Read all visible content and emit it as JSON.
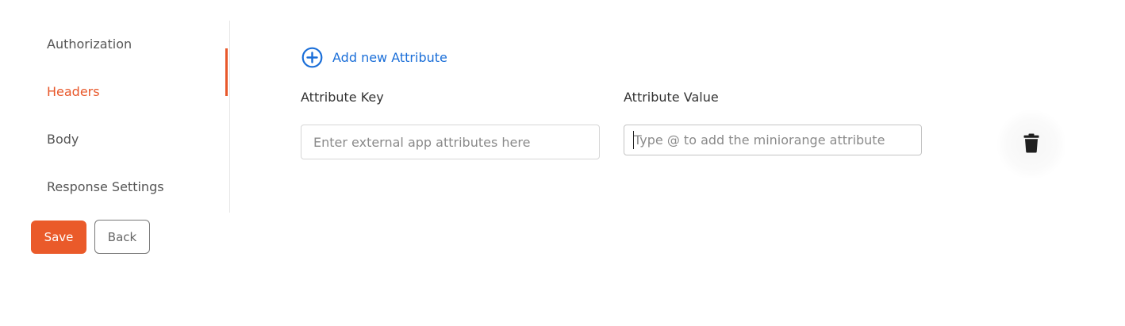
{
  "sidebar": {
    "items": [
      {
        "label": "Authorization",
        "active": false
      },
      {
        "label": "Headers",
        "active": true
      },
      {
        "label": "Body",
        "active": false
      },
      {
        "label": "Response Settings",
        "active": false
      }
    ]
  },
  "actions": {
    "save_label": "Save",
    "back_label": "Back"
  },
  "main": {
    "add_attribute_label": "Add new Attribute",
    "attribute_key_label": "Attribute Key",
    "attribute_value_label": "Attribute Value",
    "attribute_key_placeholder": "Enter external app attributes here",
    "attribute_key_value": "",
    "attribute_value_placeholder": "Type @ to add the miniorange attribute",
    "attribute_value_value": ""
  },
  "icons": {
    "add": "plus-circle-icon",
    "delete": "trash-icon"
  },
  "colors": {
    "accent": "#e8582b",
    "link": "#1a6ed8",
    "sidebar_text": "#555555"
  }
}
